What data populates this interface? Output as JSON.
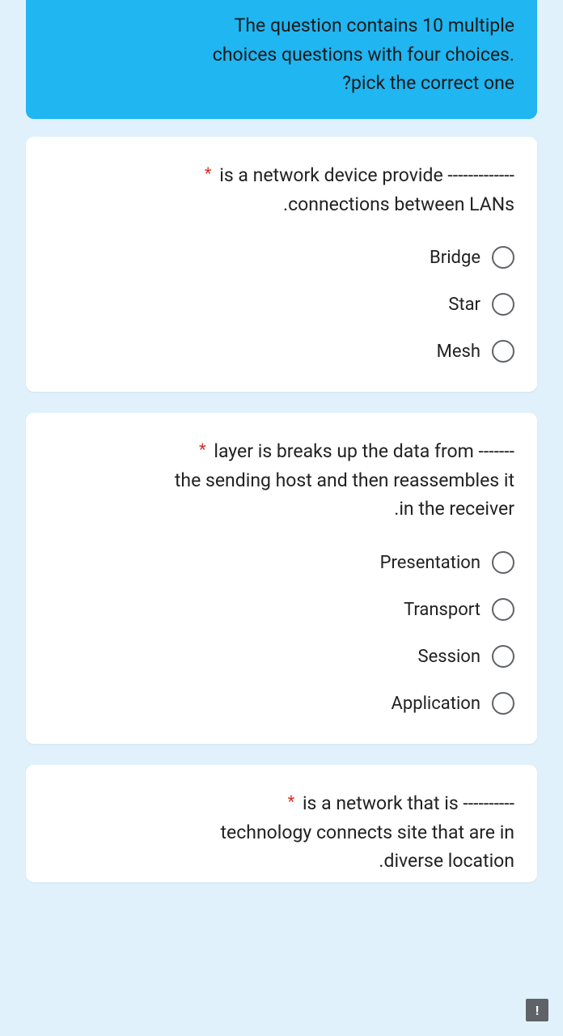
{
  "header": {
    "line1": "The question contains 10 multiple",
    "line2": "choices questions with four choices.",
    "line3": "?pick the correct one"
  },
  "questions": [
    {
      "required_mark": "*",
      "text_l1": "is a network device provide -------------",
      "text_l2": ".connections between LANs",
      "options": [
        {
          "label": "Bridge"
        },
        {
          "label": "Star"
        },
        {
          "label": "Mesh"
        }
      ]
    },
    {
      "required_mark": "*",
      "text_l1": "layer is breaks up the data from -------",
      "text_l2": "the sending host and then reassembles it",
      "text_l3": ".in the receiver",
      "options": [
        {
          "label": "Presentation"
        },
        {
          "label": "Transport"
        },
        {
          "label": "Session"
        },
        {
          "label": "Application"
        }
      ]
    },
    {
      "required_mark": "*",
      "text_l1": "is a network that is ----------",
      "text_l2": "technology connects site that are in",
      "text_l3": ".diverse location",
      "options": []
    }
  ],
  "feedback_icon": "!"
}
